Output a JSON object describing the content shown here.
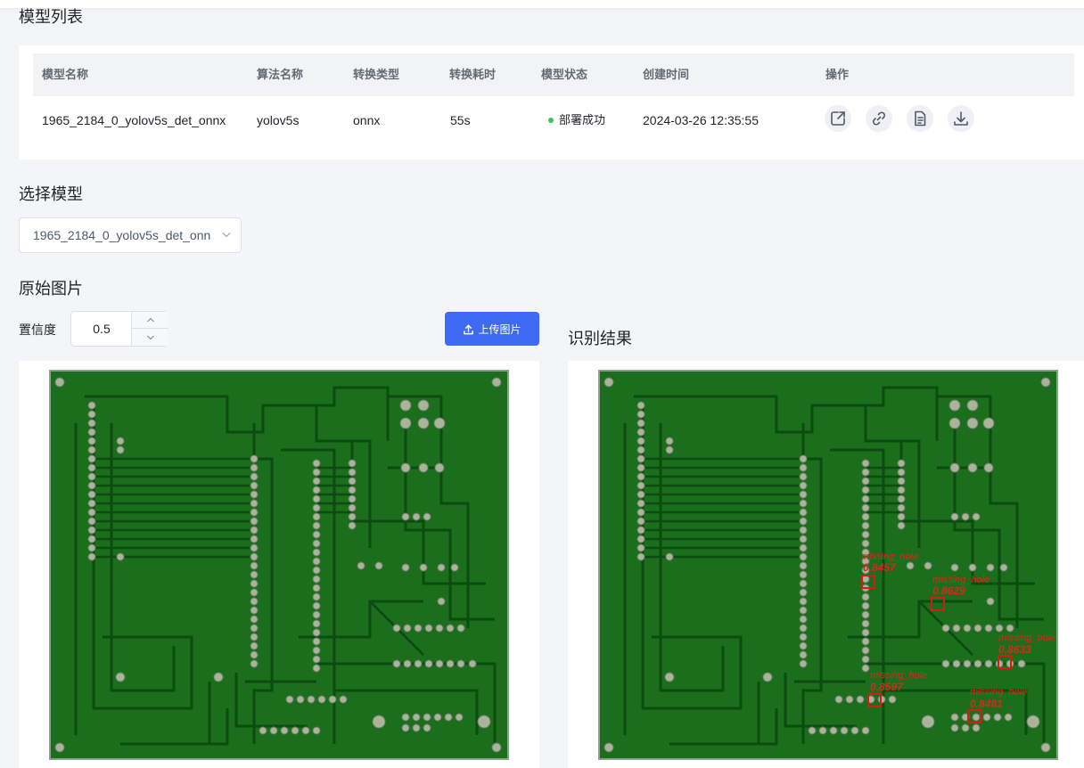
{
  "model_list": {
    "title": "模型列表",
    "columns": [
      "模型名称",
      "算法名称",
      "转换类型",
      "转换耗时",
      "模型状态",
      "创建时间",
      "操作"
    ],
    "row": {
      "name": "1965_2184_0_yolov5s_det_onnx",
      "algorithm": "yolov5s",
      "convert_type": "onnx",
      "convert_time": "55s",
      "status": "部署成功",
      "created": "2024-03-26 12:35:55"
    },
    "actions": [
      "share-icon",
      "link-icon",
      "document-icon",
      "download-icon"
    ]
  },
  "select_model": {
    "title": "选择模型",
    "value": "1965_2184_0_yolov5s_det_onn"
  },
  "original": {
    "title": "原始图片",
    "confidence_label": "置信度",
    "confidence_value": "0.5",
    "upload_label": "上传图片"
  },
  "result": {
    "title": "识别结果",
    "detections": [
      {
        "label": "missing_hole",
        "score": "0.8457"
      },
      {
        "label": "missing_hole",
        "score": "0.8629"
      },
      {
        "label": "missing_hole",
        "score": "0.8633"
      },
      {
        "label": "missing_hole",
        "score": "0.8597"
      },
      {
        "label": "missing_hole",
        "score": "0.8481"
      }
    ]
  },
  "colors": {
    "accent": "#3f6af5",
    "status_success": "#34c759",
    "pcb_green": "#1a6e1c",
    "detection_red": "#e0241a"
  }
}
